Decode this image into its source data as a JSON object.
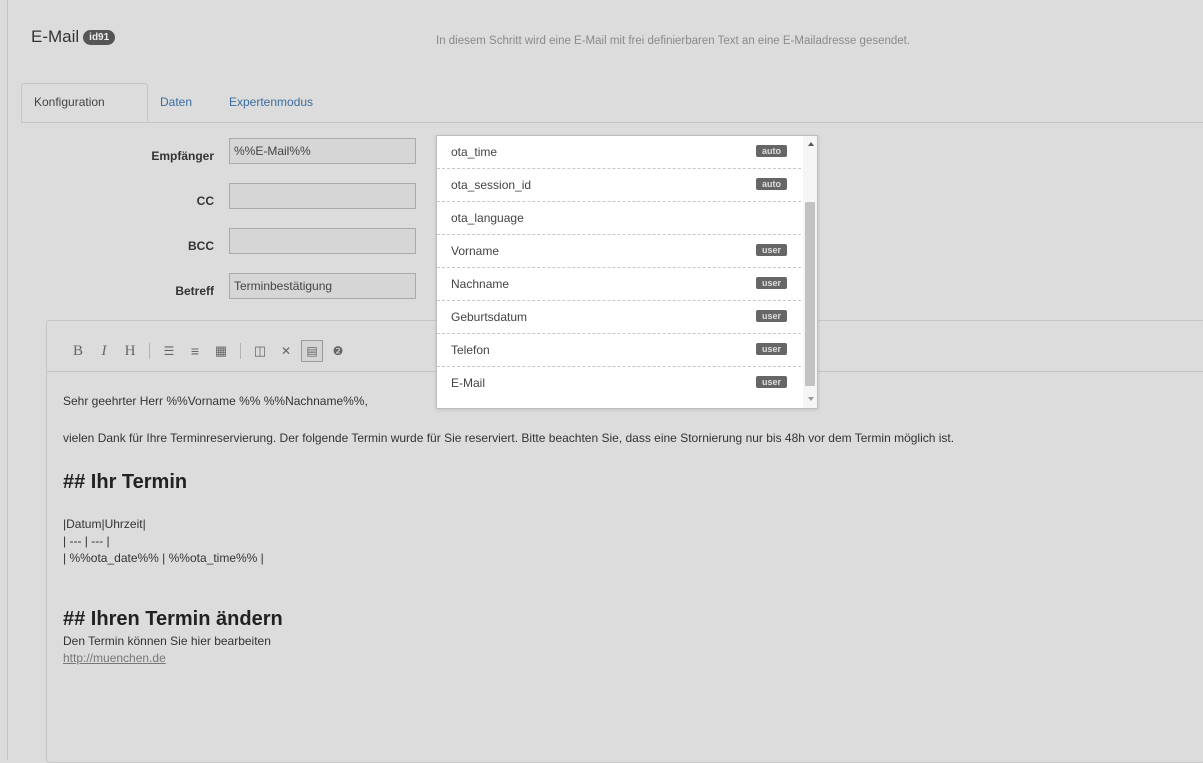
{
  "header": {
    "title": "E-Mail",
    "id_badge": "id91",
    "description": "In diesem Schritt wird eine E-Mail mit frei definierbaren Text an eine E-Mailadresse gesendet."
  },
  "tabs": [
    {
      "label": "Konfiguration",
      "active": true
    },
    {
      "label": "Daten",
      "active": false
    },
    {
      "label": "Expertenmodus",
      "active": false
    }
  ],
  "form": {
    "recipient_label": "Empfänger",
    "recipient_value": "%%E-Mail%%",
    "cc_label": "CC",
    "cc_value": "",
    "bcc_label": "BCC",
    "bcc_value": "",
    "subject_label": "Betreff",
    "subject_value": "Terminbestätigung"
  },
  "toolbar": {
    "icons": [
      "bold-icon",
      "italic-icon",
      "heading-icon",
      "unordered-list-icon",
      "ordered-list-icon",
      "table-icon",
      "side-by-side-icon",
      "fullscreen-icon",
      "preview-icon",
      "help-icon"
    ],
    "glyphs": {
      "bold": "B",
      "italic": "I",
      "heading": "H",
      "ul": "☰",
      "ol": "≡",
      "table": "▦",
      "side": "◫",
      "full": "✕",
      "preview": "▤",
      "help": "❷"
    }
  },
  "dropdown": {
    "options": [
      {
        "label": "ota_time",
        "tag": "auto"
      },
      {
        "label": "ota_session_id",
        "tag": "auto"
      },
      {
        "label": "ota_language",
        "tag": ""
      },
      {
        "label": "Vorname",
        "tag": "user"
      },
      {
        "label": "Nachname",
        "tag": "user"
      },
      {
        "label": "Geburtsdatum",
        "tag": "user"
      },
      {
        "label": "Telefon",
        "tag": "user"
      },
      {
        "label": "E-Mail",
        "tag": "user"
      }
    ]
  },
  "editor": {
    "greeting": "Sehr geehrter Herr  %%Vorname %%  %%Nachname%%,",
    "paragraph": "vielen Dank für Ihre Terminreservierung. Der folgende Termin wurde für Sie reserviert. Bitte beachten Sie, dass eine Stornierung nur bis 48h vor dem Termin möglich ist.",
    "heading1": "## Ihr Termin",
    "table_line1": "|Datum|Uhrzeit|",
    "table_line2": "| --- | --- |",
    "table_line3": "|  %%ota_date%%  |  %%ota_time%% |",
    "heading2": "## Ihren Termin ändern",
    "change_text": "Den Termin können Sie hier bearbeiten",
    "link": "http://muenchen.de"
  }
}
